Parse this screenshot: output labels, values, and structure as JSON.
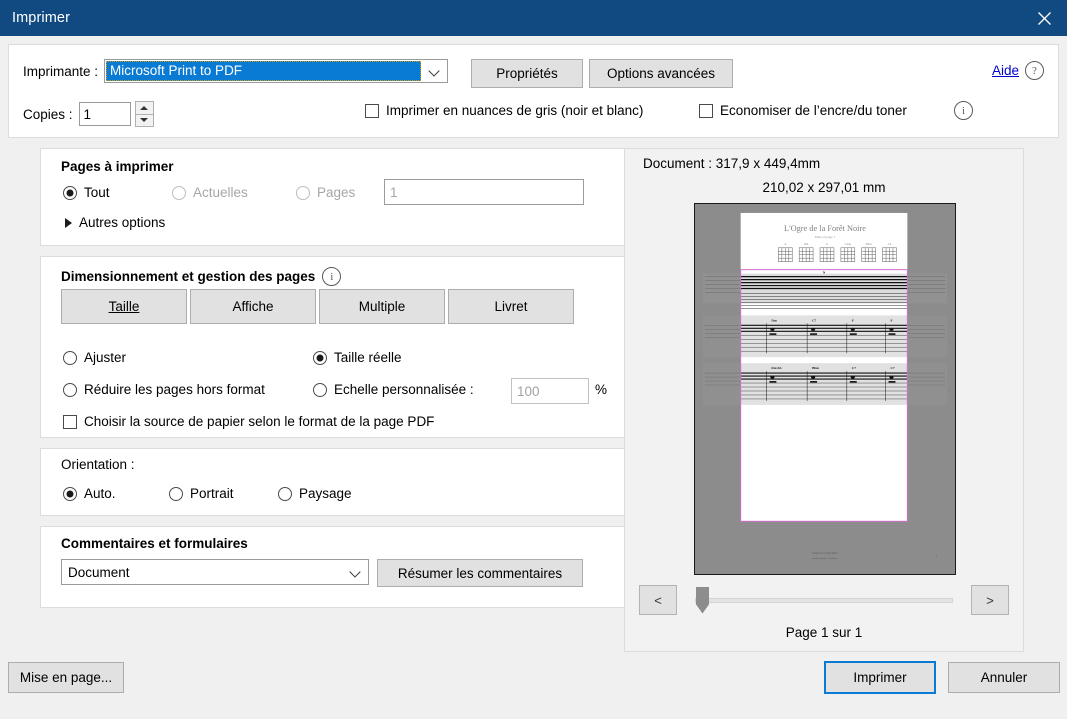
{
  "window": {
    "title": "Imprimer",
    "close_icon": "close-icon"
  },
  "printer": {
    "label": "Imprimante :",
    "selected": "Microsoft Print to PDF",
    "properties_button": "Propriétés",
    "advanced_button": "Options avancées",
    "help_link": "Aide",
    "help_icon_glyph": "?",
    "copies_label": "Copies :",
    "copies_value": "1",
    "grayscale_label": "Imprimer en nuances de gris (noir et blanc)",
    "grayscale_checked": false,
    "toner_label": "Economiser de l’encre/du toner",
    "toner_checked": false,
    "info_icon_glyph": "i"
  },
  "pages_to_print": {
    "title": "Pages à imprimer",
    "options": [
      {
        "label": "Tout",
        "checked": true,
        "disabled": false
      },
      {
        "label": "Actuelles",
        "checked": false,
        "disabled": true
      },
      {
        "label": "Pages",
        "checked": false,
        "disabled": true
      }
    ],
    "pages_input_value": "1",
    "more_options_label": "Autres options"
  },
  "sizing": {
    "title": "Dimensionnement et gestion des pages",
    "info_icon_glyph": "i",
    "mode_buttons": [
      "Taille",
      "Affiche",
      "Multiple",
      "Livret"
    ],
    "active_mode": "Taille",
    "scale_options": [
      {
        "label": "Ajuster",
        "checked": false
      },
      {
        "label": "Taille réelle",
        "checked": true
      },
      {
        "label": "Réduire les pages hors format",
        "checked": false
      },
      {
        "label": "Echelle personnalisée :",
        "checked": false
      }
    ],
    "custom_scale_value": "100",
    "percent_symbol": "%",
    "paper_source_label": "Choisir la source de papier selon le format de la page PDF",
    "paper_source_checked": false
  },
  "orientation": {
    "title": "Orientation :",
    "options": [
      {
        "label": "Auto.",
        "checked": true
      },
      {
        "label": "Portrait",
        "checked": false
      },
      {
        "label": "Paysage",
        "checked": false
      }
    ]
  },
  "comments": {
    "title": "Commentaires et formulaires",
    "selected": "Document",
    "summary_button": "Résumer les commentaires"
  },
  "preview": {
    "document_size": "Document : 317,9 x 449,4mm",
    "page_size": "210,02 x 297,01 mm",
    "prev_button": "<",
    "next_button": ">",
    "page_count": "Page 1 sur 1",
    "slider_position_pct": 0,
    "sheet_title": "L'Ogre de la Forêt Noire",
    "sheet_subtitle": "Mise en page 1",
    "sheet_chord_labels": [
      "A",
      "Dm",
      "G",
      "Cmaj",
      "Bbm",
      "C#"
    ],
    "sheet_measure_labels_row2": [
      "Dm",
      "C7",
      "F",
      "F"
    ],
    "sheet_measure_labels_row3": [
      "Fm/Ab",
      "Bbm",
      "C7",
      "C7"
    ],
    "sheet_footer": "L'Ogre de la Forêt Noire — partition guitare / tablature",
    "crop_overlay_color": "#cf6ecf"
  },
  "footer": {
    "page_setup_button": "Mise en page...",
    "print_button": "Imprimer",
    "cancel_button": "Annuler"
  },
  "colors": {
    "titlebar": "#104a81",
    "accent": "#0a7bd4",
    "panel_bg": "#ffffff",
    "dialog_bg": "#f0f0f0",
    "button_face": "#e1e1e1",
    "link": "#0000d0"
  }
}
